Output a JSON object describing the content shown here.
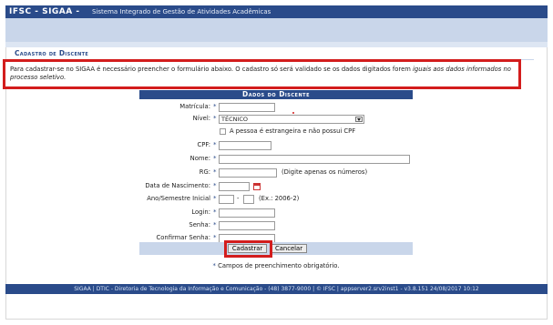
{
  "header": {
    "brand": "IFSC - SIGAA -",
    "system_name": "Sistema Integrado de Gestão de Atividades Acadêmicas"
  },
  "page_title": "Cadastro de Discente",
  "info": {
    "text": "Para cadastrar-se no SIGAA é necessário preencher o formulário abaixo. O cadastro só será validado se os dados digitados forem ",
    "emphasis": "iguais aos dados informados no processo seletivo."
  },
  "form": {
    "title": "Dados do Discente",
    "fields": {
      "matricula": {
        "label": "Matrícula:",
        "value": ""
      },
      "nivel": {
        "label": "Nível:",
        "value": "TÉCNICO"
      },
      "estrangeira": {
        "label": "A pessoa é estrangeira e não possui CPF"
      },
      "cpf": {
        "label": "CPF:",
        "value": ""
      },
      "nome": {
        "label": "Nome:",
        "value": ""
      },
      "rg": {
        "label": "RG:",
        "value": "",
        "hint": "(Digite apenas os números)"
      },
      "nascimento": {
        "label": "Data de Nascimento:",
        "value": ""
      },
      "ano_semestre": {
        "label": "Ano/Semestre Inicial",
        "separator": "-",
        "hint": "(Ex.: 2006-2)"
      },
      "login": {
        "label": "Login:",
        "value": ""
      },
      "senha": {
        "label": "Senha:",
        "value": ""
      },
      "confirmar_senha": {
        "label": "Confirmar Senha:",
        "value": ""
      }
    },
    "buttons": {
      "submit": "Cadastrar",
      "cancel": "Cancelar"
    },
    "required_mark": "*",
    "required_note": "Campos de preenchimento obrigatório."
  },
  "footer": {
    "text": "SIGAA | DTIC - Diretoria de Tecnologia da Informação e Comunicação - (48) 3877-9000 | © IFSC | appserver2.srv2inst1 - v3.8.151 24/08/2017 10:12"
  },
  "colors": {
    "primary": "#2a4b8a",
    "band": "#c9d6ea",
    "highlight": "#d31d1d"
  }
}
